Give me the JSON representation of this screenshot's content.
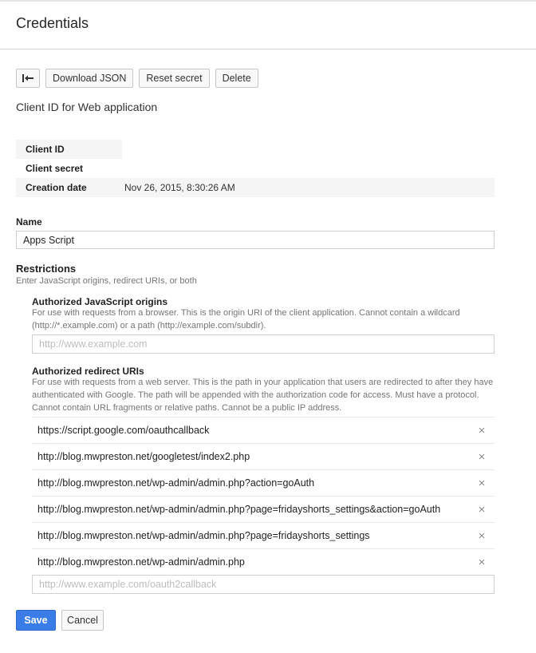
{
  "header": {
    "title": "Credentials"
  },
  "toolbar": {
    "back_icon": "back-arrow-icon",
    "download_json": "Download JSON",
    "reset_secret": "Reset secret",
    "delete": "Delete"
  },
  "client": {
    "subtitle": "Client ID for Web application",
    "info": [
      {
        "label": "Client ID",
        "value": ""
      },
      {
        "label": "Client secret",
        "value": ""
      },
      {
        "label": "Creation date",
        "value": "Nov 26, 2015, 8:30:26 AM"
      }
    ]
  },
  "name": {
    "label": "Name",
    "value": "Apps Script"
  },
  "restrictions": {
    "title": "Restrictions",
    "help": "Enter JavaScript origins, redirect URIs, or both",
    "js_origins": {
      "title": "Authorized JavaScript origins",
      "help": "For use with requests from a browser. This is the origin URI of the client application. Cannot contain a wildcard (http://*.example.com) or a path (http://example.com/subdir).",
      "placeholder": "http://www.example.com"
    },
    "redirect_uris": {
      "title": "Authorized redirect URIs",
      "help": "For use with requests from a web server. This is the path in your application that users are redirected to after they have authenticated with Google. The path will be appended with the authorization code for access. Must have a protocol. Cannot contain URL fragments or relative paths. Cannot be a public IP address.",
      "items": [
        "https://script.google.com/oauthcallback",
        "http://blog.mwpreston.net/googletest/index2.php",
        "http://blog.mwpreston.net/wp-admin/admin.php?action=goAuth",
        "http://blog.mwpreston.net/wp-admin/admin.php?page=fridayshorts_settings&action=goAuth",
        "http://blog.mwpreston.net/wp-admin/admin.php?page=fridayshorts_settings",
        "http://blog.mwpreston.net/wp-admin/admin.php"
      ],
      "remove_symbol": "×",
      "placeholder": "http://www.example.com/oauth2callback"
    }
  },
  "actions": {
    "save": "Save",
    "cancel": "Cancel"
  },
  "colors": {
    "primary": "#3a7de8"
  }
}
